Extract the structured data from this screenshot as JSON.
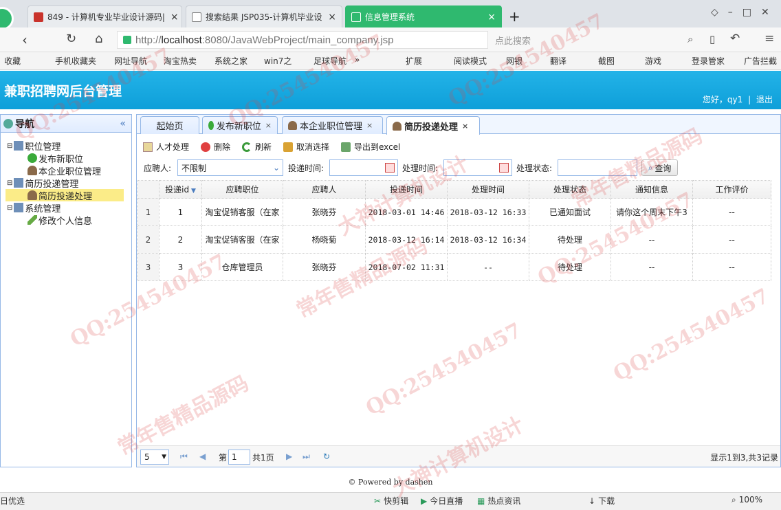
{
  "browser": {
    "tabs": [
      {
        "title": "849 - 计算机专业毕业设计源码|"
      },
      {
        "title": "搜索结果 JSP035-计算机毕业设"
      },
      {
        "title": "信息管理系统"
      }
    ],
    "new_tab_symbol": "+",
    "url_prefix": "http://",
    "url_host": "localhost",
    "url_rest": ":8080/JavaWebProject/main_company.jsp",
    "search_placeholder": "点此搜索",
    "bookmarks": [
      "收藏",
      "手机收藏夹",
      "网址导航",
      "淘宝热卖",
      "系统之家",
      "win7之",
      "足球导航",
      "»",
      "扩展",
      "阅读模式",
      "网银",
      "翻译",
      "截图",
      "游戏",
      "登录管家",
      "广告拦截"
    ]
  },
  "app": {
    "title": "兼职招聘网后台管理",
    "greeting": "您好，qy1",
    "separator": "|",
    "logout": "退出"
  },
  "nav": {
    "title": "导航",
    "collapse": "«",
    "items": [
      {
        "label": "职位管理"
      },
      {
        "label": "发布新职位"
      },
      {
        "label": "本企业职位管理"
      },
      {
        "label": "简历投递管理"
      },
      {
        "label": "简历投递处理"
      },
      {
        "label": "系统管理"
      },
      {
        "label": "修改个人信息"
      }
    ]
  },
  "tabs": [
    {
      "label": "起始页"
    },
    {
      "label": "发布新职位"
    },
    {
      "label": "本企业职位管理"
    },
    {
      "label": "简历投递处理"
    }
  ],
  "toolbar": {
    "process": "人才处理",
    "delete": "删除",
    "refresh": "刷新",
    "unselect": "取消选择",
    "export": "导出到excel"
  },
  "filters": {
    "applicant_label": "应聘人:",
    "applicant_value": "不限制",
    "submit_time_label": "投递时间:",
    "process_time_label": "处理时间:",
    "status_label": "处理状态:",
    "query": "查询"
  },
  "grid": {
    "columns": [
      "投递id",
      "应聘职位",
      "应聘人",
      "投递时间",
      "处理时间",
      "处理状态",
      "通知信息",
      "工作评价"
    ],
    "rows": [
      {
        "rn": "1",
        "id": "1",
        "job": "淘宝促销客服（在家",
        "person": "张晓芬",
        "submit": "2018-03-01 14:46",
        "handled": "2018-03-12 16:33",
        "status": "已通知面试",
        "notice": "请你这个周末下午3",
        "eval": "--"
      },
      {
        "rn": "2",
        "id": "2",
        "job": "淘宝促销客服（在家",
        "person": "杨晓菊",
        "submit": "2018-03-12 16:14",
        "handled": "2018-03-12 16:34",
        "status": "待处理",
        "notice": "--",
        "eval": "--"
      },
      {
        "rn": "3",
        "id": "3",
        "job": "仓库管理员",
        "person": "张晓芬",
        "submit": "2018-07-02 11:31",
        "handled": "--",
        "status": "待处理",
        "notice": "--",
        "eval": "--"
      }
    ]
  },
  "pager": {
    "size": "5",
    "page_prefix": "第",
    "page": "1",
    "page_total": "共1页",
    "summary": "显示1到3,共3记录"
  },
  "footer": "© Powered by dashen",
  "statusbar": [
    "日优选",
    "快剪辑",
    "今日直播",
    "热点资讯",
    "下载",
    "100%"
  ],
  "watermarks": [
    "QQ:254540457",
    "常年售精品源码",
    "大神计算机设计"
  ]
}
